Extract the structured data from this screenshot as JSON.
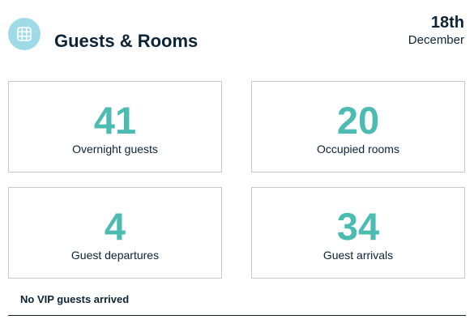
{
  "header": {
    "icon": "grid-icon",
    "title": "Guests & Rooms",
    "date_day": "18th",
    "date_month": "December"
  },
  "stats": [
    {
      "value": "41",
      "label": "Overnight guests"
    },
    {
      "value": "20",
      "label": "Occupied rooms"
    },
    {
      "value": "4",
      "label": "Guest departures"
    },
    {
      "value": "34",
      "label": "Guest arrivals"
    }
  ],
  "footer": {
    "vip_note": "No VIP guests arrived"
  },
  "colors": {
    "accent": "#4cbcb3",
    "icon_bg": "#9fdbe6",
    "text": "#0d2436",
    "card_border": "#c9c9c9"
  }
}
